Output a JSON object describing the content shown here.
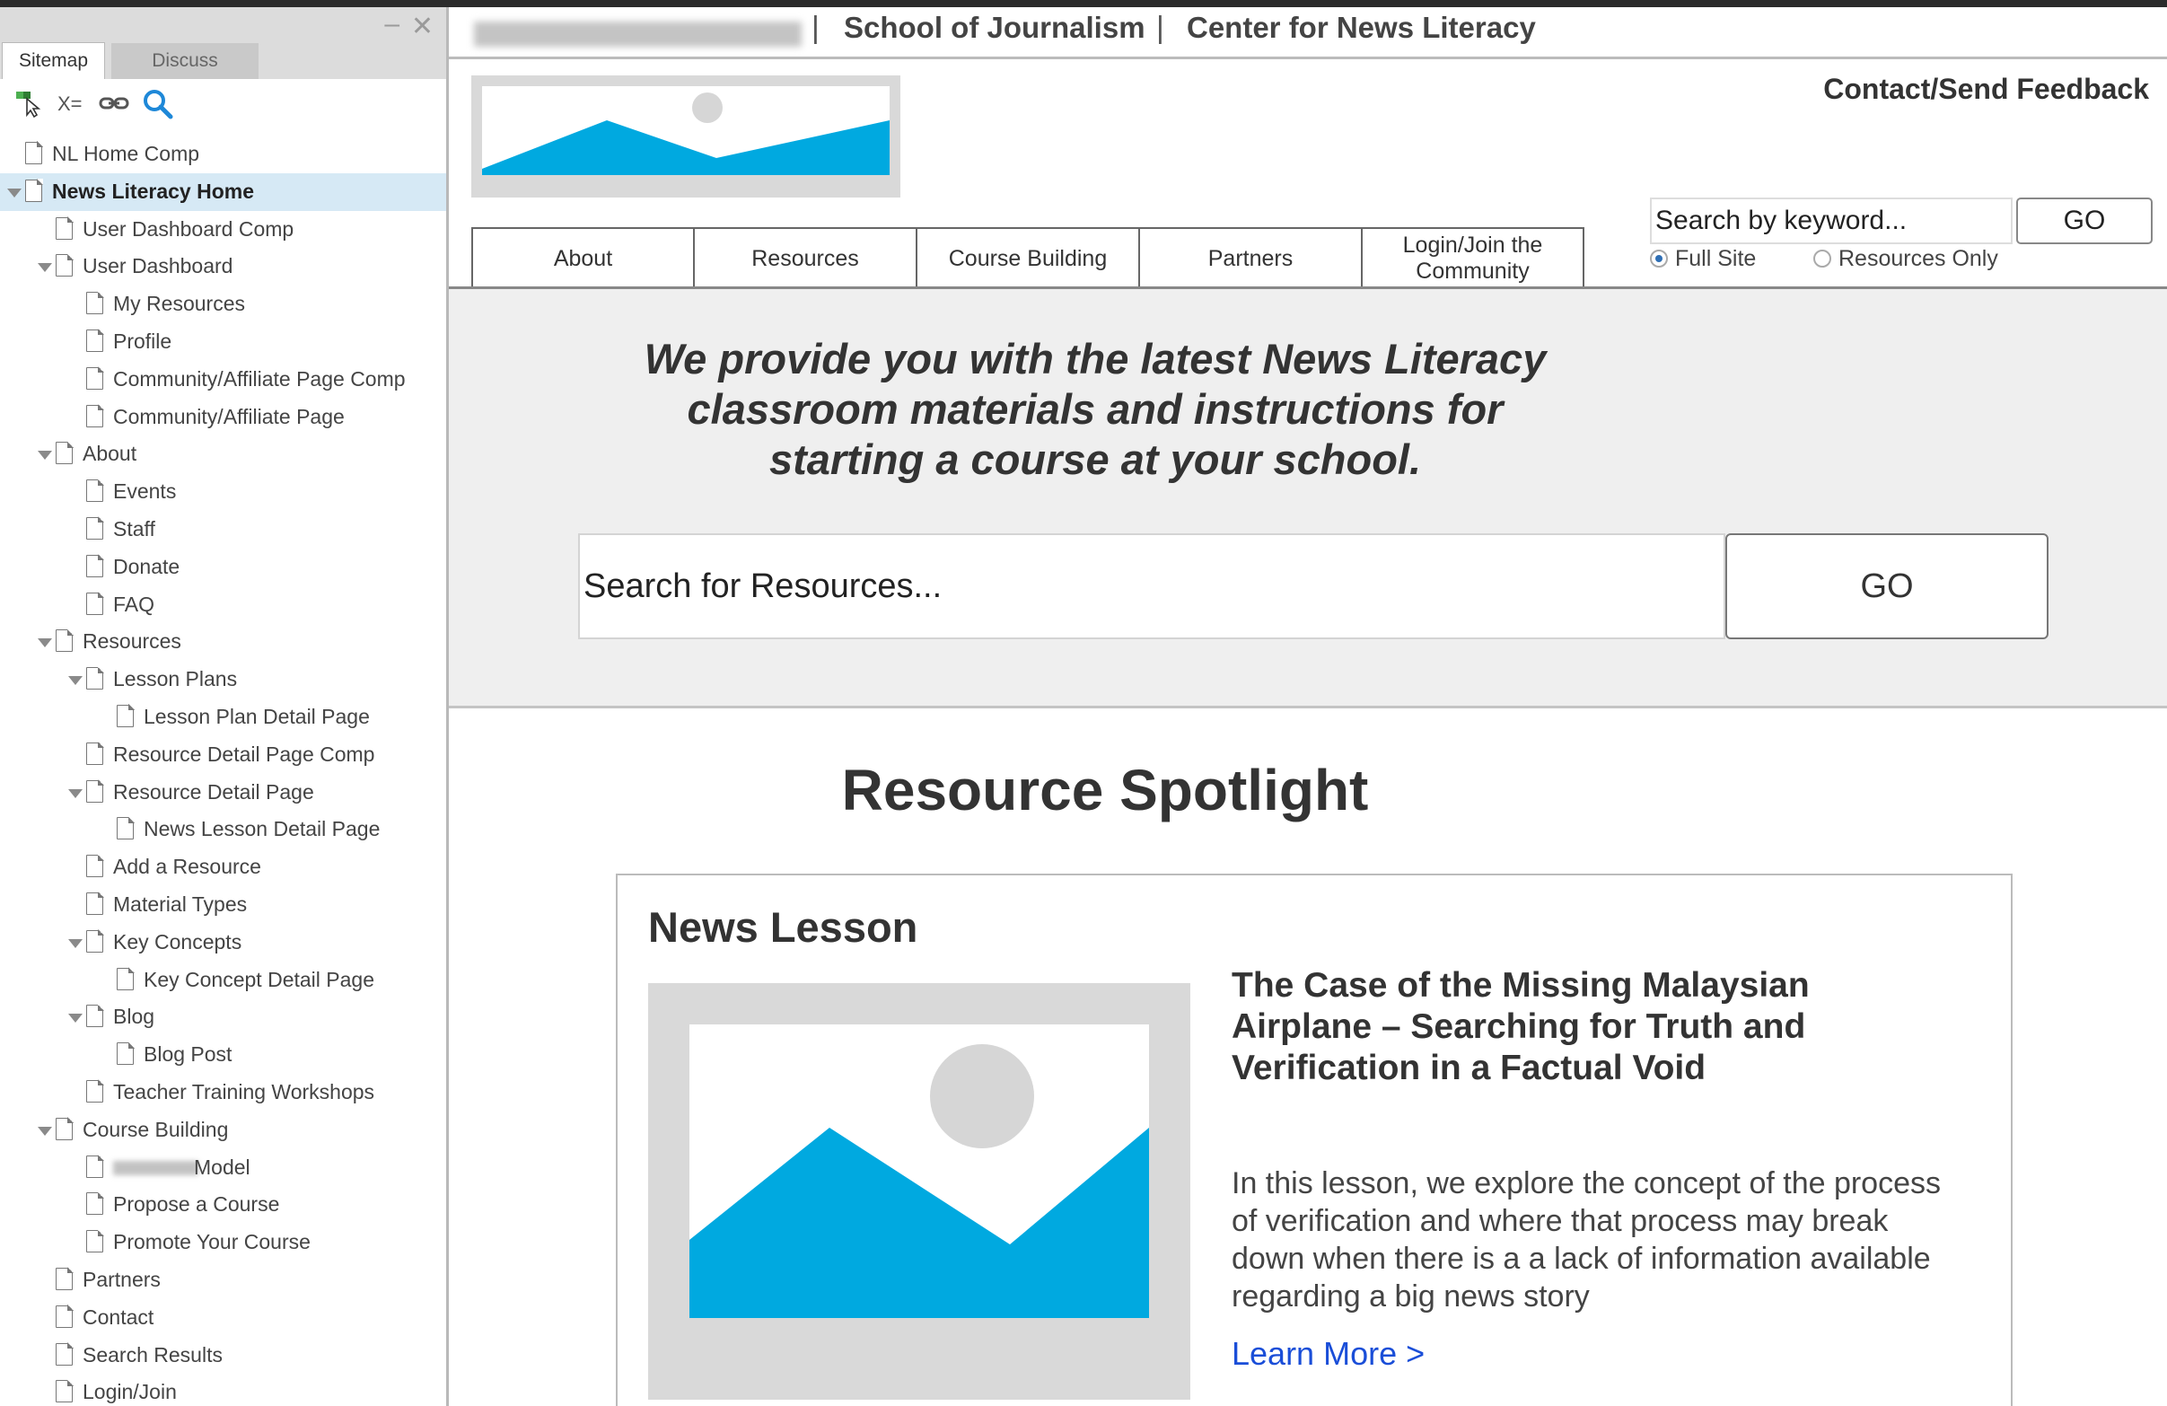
{
  "panel": {
    "tabs": {
      "active": "Sitemap",
      "inactive": "Discuss"
    },
    "toolbar": {
      "fields_label": "X="
    },
    "tree": [
      {
        "label": "NL Home Comp",
        "level": 1,
        "expanded": false,
        "selected": false
      },
      {
        "label": "News Literacy Home",
        "level": 1,
        "expanded": true,
        "selected": true
      },
      {
        "label": "User Dashboard Comp",
        "level": 2,
        "expanded": false
      },
      {
        "label": "User Dashboard",
        "level": 2,
        "expanded": true
      },
      {
        "label": "My Resources",
        "level": 3,
        "expanded": false
      },
      {
        "label": "Profile",
        "level": 3,
        "expanded": false
      },
      {
        "label": "Community/Affiliate Page Comp",
        "level": 3,
        "expanded": false
      },
      {
        "label": "Community/Affiliate Page",
        "level": 3,
        "expanded": false
      },
      {
        "label": "About",
        "level": 2,
        "expanded": true
      },
      {
        "label": "Events",
        "level": 3,
        "expanded": false
      },
      {
        "label": "Staff",
        "level": 3,
        "expanded": false
      },
      {
        "label": "Donate",
        "level": 3,
        "expanded": false
      },
      {
        "label": "FAQ",
        "level": 3,
        "expanded": false
      },
      {
        "label": "Resources",
        "level": 2,
        "expanded": true
      },
      {
        "label": "Lesson Plans",
        "level": 3,
        "expanded": true
      },
      {
        "label": "Lesson Plan Detail Page",
        "level": 4,
        "expanded": false
      },
      {
        "label": "Resource Detail Page Comp",
        "level": 3,
        "expanded": false
      },
      {
        "label": "Resource Detail Page",
        "level": 3,
        "expanded": true
      },
      {
        "label": "News Lesson Detail Page",
        "level": 4,
        "expanded": false
      },
      {
        "label": "Add a Resource",
        "level": 3,
        "expanded": false
      },
      {
        "label": "Material Types",
        "level": 3,
        "expanded": false
      },
      {
        "label": "Key Concepts",
        "level": 3,
        "expanded": true
      },
      {
        "label": "Key Concept Detail Page",
        "level": 4,
        "expanded": false
      },
      {
        "label": "Blog",
        "level": 3,
        "expanded": true
      },
      {
        "label": "Blog Post",
        "level": 4,
        "expanded": false
      },
      {
        "label": "Teacher Training Workshops",
        "level": 3,
        "expanded": false
      },
      {
        "label": "Course Building",
        "level": 2,
        "expanded": true
      },
      {
        "label": "Model",
        "level": 3,
        "expanded": false,
        "blurred_prefix": true
      },
      {
        "label": "Propose a Course",
        "level": 3,
        "expanded": false
      },
      {
        "label": "Promote Your Course",
        "level": 3,
        "expanded": false
      },
      {
        "label": "Partners",
        "level": 2,
        "expanded": false
      },
      {
        "label": "Contact",
        "level": 2,
        "expanded": false
      },
      {
        "label": "Search Results",
        "level": 2,
        "expanded": false
      },
      {
        "label": "Login/Join",
        "level": 2,
        "expanded": false
      }
    ]
  },
  "header": {
    "school": "School of Journalism",
    "center": "Center for News Literacy",
    "separator": "|",
    "contact": "Contact/Send Feedback"
  },
  "nav": [
    "About",
    "Resources",
    "Course Building",
    "Partners",
    "Login/Join the Community"
  ],
  "keyword_search": {
    "placeholder": "Search by keyword...",
    "go": "GO",
    "options": [
      "Full Site",
      "Resources Only"
    ],
    "selected": "Full Site"
  },
  "hero": {
    "tagline": "We provide you with the latest News Literacy classroom materials and instructions for starting a course at your school.",
    "search_placeholder": "Search for Resources...",
    "go": "GO"
  },
  "spotlight": {
    "title": "Resource Spotlight",
    "card": {
      "category": "News Lesson",
      "title": "The Case of the Missing Malaysian Airplane – Searching for Truth and Verification in a Factual Void",
      "description": "In this lesson, we explore the concept of the process of verification and where that process may break down when there is a a lack of information available regarding a big news story",
      "link": "Learn More >"
    }
  },
  "colors": {
    "accent_blue": "#00a9e0",
    "link_blue": "#1a4ed8",
    "selected_row": "#d6e9f5",
    "placeholder_gray": "#d9d9d9"
  }
}
